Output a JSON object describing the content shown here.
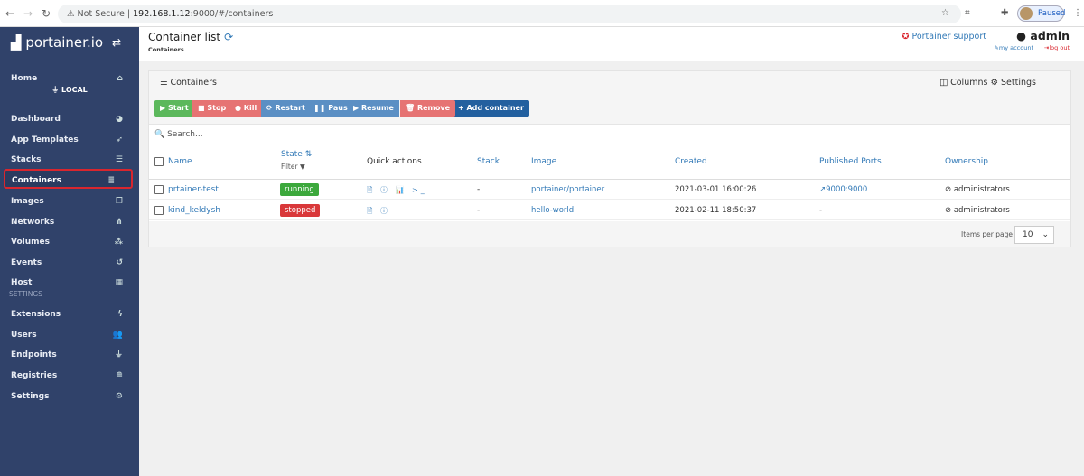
{
  "browser": {
    "security": "Not Secure",
    "url_host": "192.168.1.12",
    "url_rest": ":9000/#/containers",
    "profile": "Paused"
  },
  "sidebar": {
    "logo": "portainer.io",
    "endpoint": "LOCAL",
    "settings_header": "SETTINGS",
    "items": [
      {
        "label": "Home",
        "icon": "home-icon",
        "glyph": "⌂"
      },
      {
        "label": "Dashboard",
        "icon": "tachometer-icon",
        "glyph": "◕"
      },
      {
        "label": "App Templates",
        "icon": "rocket-icon",
        "glyph": "➶"
      },
      {
        "label": "Stacks",
        "icon": "th-list-icon",
        "glyph": "☰"
      },
      {
        "label": "Containers",
        "icon": "server-icon",
        "glyph": "≣"
      },
      {
        "label": "Images",
        "icon": "clone-icon",
        "glyph": "❐"
      },
      {
        "label": "Networks",
        "icon": "sitemap-icon",
        "glyph": "⋔"
      },
      {
        "label": "Volumes",
        "icon": "cubes-icon",
        "glyph": "⁂"
      },
      {
        "label": "Events",
        "icon": "history-icon",
        "glyph": "↺"
      },
      {
        "label": "Host",
        "icon": "th-icon",
        "glyph": "▦"
      }
    ],
    "settings_items": [
      {
        "label": "Extensions",
        "icon": "bolt-icon",
        "glyph": "ϟ"
      },
      {
        "label": "Users",
        "icon": "users-icon",
        "glyph": "👥"
      },
      {
        "label": "Endpoints",
        "icon": "plug-icon",
        "glyph": "⏚"
      },
      {
        "label": "Registries",
        "icon": "database-icon",
        "glyph": "≘"
      },
      {
        "label": "Settings",
        "icon": "cogs-icon",
        "glyph": "⚙"
      }
    ]
  },
  "header": {
    "title": "Container list",
    "breadcrumb": "Containers",
    "support": "Portainer support",
    "user": "admin",
    "my_account": "my account",
    "log_out": "log out"
  },
  "panel": {
    "title": "Containers",
    "columns": "Columns",
    "settings": "Settings",
    "actions": [
      {
        "label": "Start",
        "color": "#5cb85c"
      },
      {
        "label": "Stop",
        "color": "#e67373"
      },
      {
        "label": "Kill",
        "color": "#e67373"
      },
      {
        "label": "Restart",
        "color": "#5b8fc4"
      },
      {
        "label": "Pause",
        "color": "#5b8fc4"
      },
      {
        "label": "Resume",
        "color": "#5b8fc4"
      },
      {
        "label": "Remove",
        "color": "#e67373"
      }
    ],
    "add": "+ Add container",
    "search_placeholder": "Search...",
    "headers": {
      "name": "Name",
      "state": "State",
      "filter": "Filter",
      "quick": "Quick actions",
      "stack": "Stack",
      "image": "Image",
      "created": "Created",
      "ports": "Published Ports",
      "owner": "Ownership"
    },
    "rows": [
      {
        "name": "prtainer-test",
        "state": "running",
        "state_color": "#3ca83c",
        "quick": "🗎 ⓘ 📊 >_",
        "stack": "-",
        "image": "portainer/portainer",
        "created": "2021-03-01 16:00:26",
        "ports": "9000:9000",
        "owner": "administrators"
      },
      {
        "name": "kind_keldysh",
        "state": "stopped",
        "state_color": "#d9383a",
        "quick": "🗎 ⓘ",
        "stack": "-",
        "image": "hello-world",
        "created": "2021-02-11 18:50:37",
        "ports": "-",
        "owner": "administrators"
      }
    ],
    "items_per_page_label": "Items per page",
    "items_per_page": "10"
  }
}
